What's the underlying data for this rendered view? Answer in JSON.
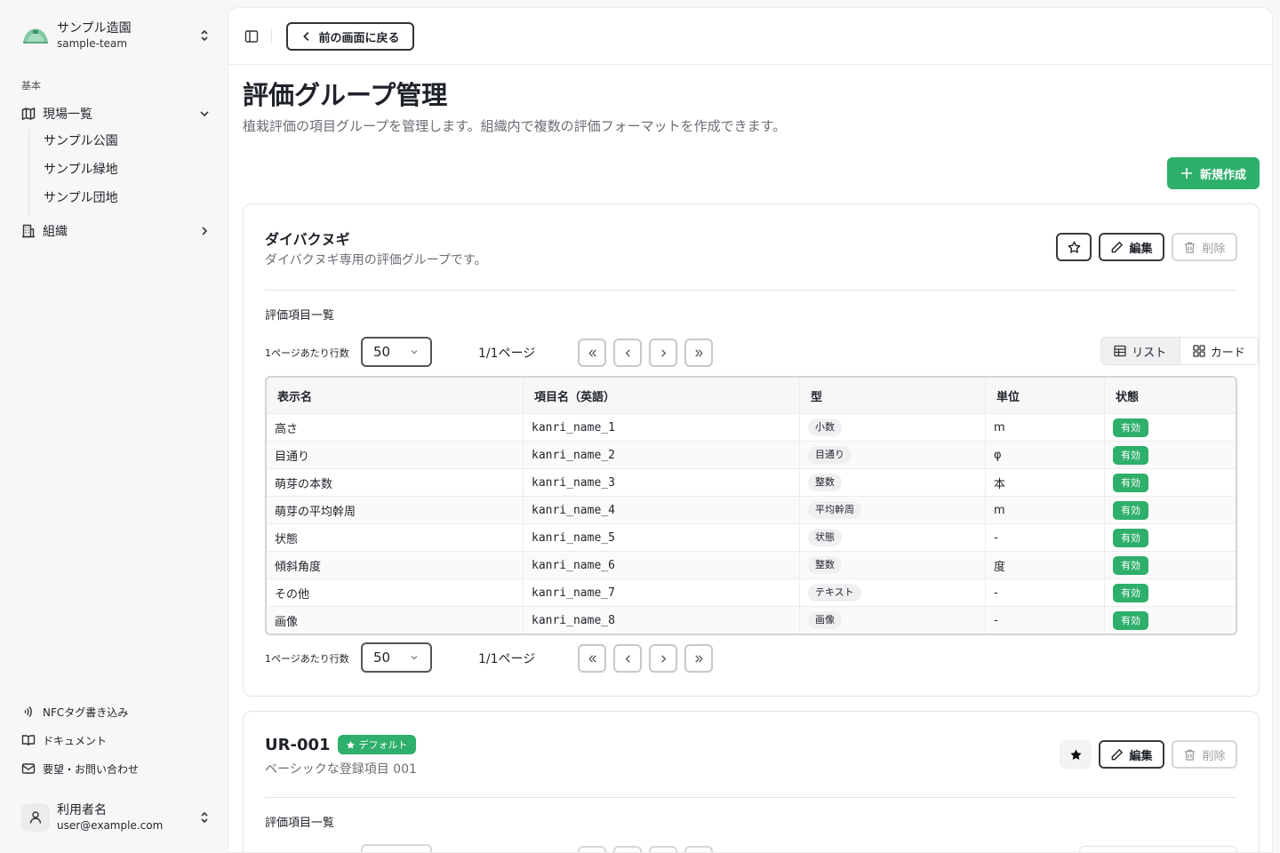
{
  "team": {
    "name": "サンプル造園",
    "slug": "sample-team"
  },
  "sidebar": {
    "section_label": "基本",
    "sites_label": "現場一覧",
    "sites": [
      "サンプル公園",
      "サンプル緑地",
      "サンプル団地"
    ],
    "org_label": "組織",
    "footer": [
      "NFCタグ書き込み",
      "ドキュメント",
      "要望・お問い合わせ"
    ]
  },
  "user": {
    "name": "利用者名",
    "email": "user@example.com"
  },
  "topbar": {
    "back_label": "前の画面に戻る"
  },
  "page": {
    "title": "評価グループ管理",
    "description": "植栽評価の項目グループを管理します。組織内で複数の評価フォーマットを作成できます。",
    "new_label": "新規作成"
  },
  "groups": [
    {
      "name": "ダイバクヌギ",
      "description": "ダイバクヌギ専用の評価グループです。",
      "edit_label": "編集",
      "delete_label": "削除",
      "items_label": "評価項目一覧"
    },
    {
      "name": "UR-001",
      "default_badge": "デフォルト",
      "description": "ベーシックな登録項目 001",
      "edit_label": "編集",
      "delete_label": "削除",
      "items_label": "評価項目一覧"
    }
  ],
  "pager": {
    "rows_label": "1ページあたり行数",
    "rows_value": "50",
    "page_info": "1/1ページ"
  },
  "view_toggle": {
    "list": "リスト",
    "card": "カード"
  },
  "table": {
    "headers": [
      "表示名",
      "項目名（英語）",
      "型",
      "単位",
      "状態"
    ],
    "rows": [
      {
        "display": "高さ",
        "key": "kanri_name_1",
        "type": "小数",
        "unit": "m",
        "status": "有効"
      },
      {
        "display": "目通り",
        "key": "kanri_name_2",
        "type": "目通り",
        "unit": "φ",
        "status": "有効"
      },
      {
        "display": "萌芽の本数",
        "key": "kanri_name_3",
        "type": "整数",
        "unit": "本",
        "status": "有効"
      },
      {
        "display": "萌芽の平均幹周",
        "key": "kanri_name_4",
        "type": "平均幹周",
        "unit": "m",
        "status": "有効"
      },
      {
        "display": "状態",
        "key": "kanri_name_5",
        "type": "状態",
        "unit": "-",
        "status": "有効"
      },
      {
        "display": "傾斜角度",
        "key": "kanri_name_6",
        "type": "整数",
        "unit": "度",
        "status": "有効"
      },
      {
        "display": "その他",
        "key": "kanri_name_7",
        "type": "テキスト",
        "unit": "-",
        "status": "有効"
      },
      {
        "display": "画像",
        "key": "kanri_name_8",
        "type": "画像",
        "unit": "-",
        "status": "有効"
      }
    ]
  },
  "colors": {
    "accent": "#2eaf6b"
  }
}
